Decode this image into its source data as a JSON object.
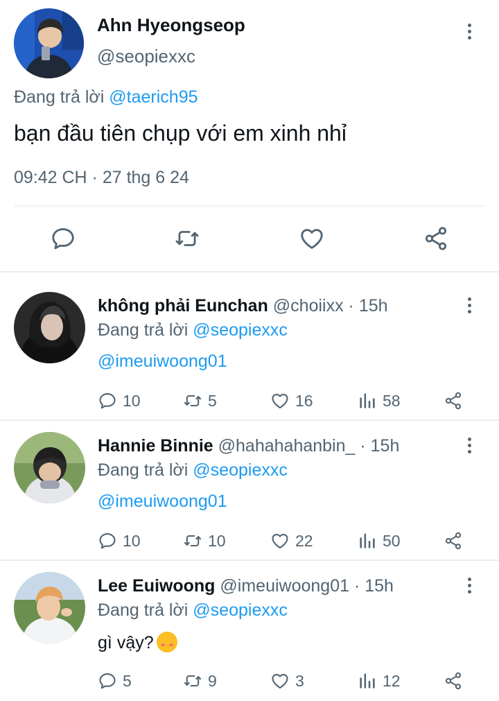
{
  "main_tweet": {
    "name": "Ahn Hyeongseop",
    "handle": "@seopiexxc",
    "replying_prefix": "Đang trả lời",
    "replying_to": "@taerich95",
    "text": "bạn đầu tiên chụp với em xinh nhỉ",
    "timestamp": "09:42 CH · 27 thg 6 24",
    "actions": [
      "reply-icon",
      "retweet-icon",
      "like-icon",
      "share-icon"
    ]
  },
  "replies": [
    {
      "name": "không phải Eunchan",
      "handle": "@choiixx",
      "time": "· 15h",
      "replying_prefix": "Đang trả lời",
      "replying_to": "@seopiexxc",
      "text": "@imeuiwoong01",
      "counts": {
        "replies": "10",
        "retweets": "5",
        "likes": "16",
        "views": "58"
      }
    },
    {
      "name": "Hannie Binnie",
      "handle": "@hahahahanbin_",
      "time": "· 15h",
      "replying_prefix": "Đang trả lời",
      "replying_to": "@seopiexxc",
      "text": "@imeuiwoong01",
      "counts": {
        "replies": "10",
        "retweets": "10",
        "likes": "22",
        "views": "50"
      }
    },
    {
      "name": "Lee Euiwoong",
      "handle": "@imeuiwoong01",
      "time": "· 15h",
      "replying_prefix": "Đang trả lời",
      "replying_to": "@seopiexxc",
      "text": "gì vậy?",
      "emoji": "smiling-face-with-hearts",
      "counts": {
        "replies": "5",
        "retweets": "9",
        "likes": "3",
        "views": "12"
      }
    }
  ],
  "colors": {
    "link": "#1d9bf0",
    "secondary_text": "#536471",
    "primary_text": "#0f1419",
    "divider": "#e6ecf0"
  }
}
